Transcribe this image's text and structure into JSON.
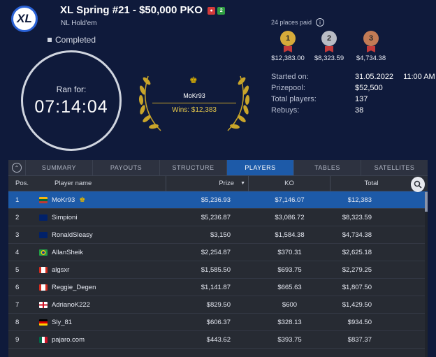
{
  "header": {
    "logo_text": "XL",
    "title": "XL Spring #21 - $50,000 PKO",
    "badge_a": "",
    "badge_b": "2",
    "game_type": "NL Hold'em",
    "status": "Completed"
  },
  "timer": {
    "label": "Ran for:",
    "value": "07:14:04"
  },
  "winner": {
    "name": "MoKr93",
    "wins": "Wins: $12,383"
  },
  "places": {
    "label": "24 places paid"
  },
  "medals": [
    {
      "rank": "1",
      "amount": "$12,383.00"
    },
    {
      "rank": "2",
      "amount": "$8,323.59"
    },
    {
      "rank": "3",
      "amount": "$4,734.38"
    }
  ],
  "stats": {
    "started_label": "Started on:",
    "started_date": "31.05.2022",
    "started_time": "11:00 AM",
    "prizepool_label": "Prizepool:",
    "prizepool": "$52,500",
    "players_label": "Total players:",
    "players": "137",
    "rebuys_label": "Rebuys:",
    "rebuys": "38"
  },
  "tabs": [
    "SUMMARY",
    "PAYOUTS",
    "STRUCTURE",
    "PLAYERS",
    "TABLES",
    "SATELLITES"
  ],
  "active_tab": "PLAYERS",
  "table": {
    "headers": {
      "pos": "Pos.",
      "name": "Player name",
      "prize": "Prize",
      "ko": "KO",
      "total": "Total"
    },
    "rows": [
      {
        "pos": "1",
        "name": "MoKr93",
        "prize": "$5,236.93",
        "ko": "$7,146.07",
        "total": "$12,383",
        "flag": "lithuania"
      },
      {
        "pos": "2",
        "name": "Simpioni",
        "prize": "$5,236.87",
        "ko": "$3,086.72",
        "total": "$8,323.59",
        "flag": "uk"
      },
      {
        "pos": "3",
        "name": "RonaldSleasy",
        "prize": "$3,150",
        "ko": "$1,584.38",
        "total": "$4,734.38",
        "flag": "uk"
      },
      {
        "pos": "4",
        "name": "AllanSheik",
        "prize": "$2,254.87",
        "ko": "$370.31",
        "total": "$2,625.18",
        "flag": "brazil"
      },
      {
        "pos": "5",
        "name": "algsxr",
        "prize": "$1,585.50",
        "ko": "$693.75",
        "total": "$2,279.25",
        "flag": "canada"
      },
      {
        "pos": "6",
        "name": "Reggie_Degen",
        "prize": "$1,141.87",
        "ko": "$665.63",
        "total": "$1,807.50",
        "flag": "canada"
      },
      {
        "pos": "7",
        "name": "AdrianoK222",
        "prize": "$829.50",
        "ko": "$600",
        "total": "$1,429.50",
        "flag": "england"
      },
      {
        "pos": "8",
        "name": "Sly_81",
        "prize": "$606.37",
        "ko": "$328.13",
        "total": "$934.50",
        "flag": "germany"
      },
      {
        "pos": "9",
        "name": "pajaro.com",
        "prize": "$443.62",
        "ko": "$393.75",
        "total": "$837.37",
        "flag": "mexico"
      }
    ]
  },
  "colors": {
    "background": "#0f1a3b",
    "active": "#1d5aa8",
    "gold": "#e0b400"
  }
}
